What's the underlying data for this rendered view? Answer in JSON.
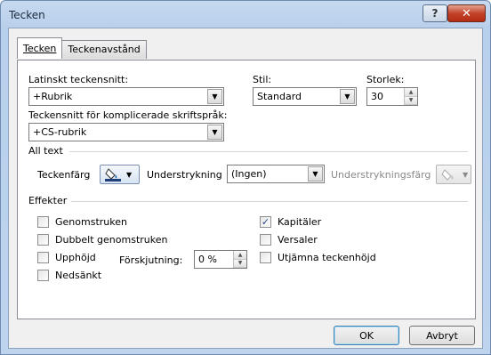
{
  "window": {
    "title": "Tecken",
    "help_glyph": "?",
    "close_glyph": "✕"
  },
  "tabs": [
    {
      "label": "Tecken"
    },
    {
      "label": "Teckenavstånd"
    }
  ],
  "font": {
    "latin_label": "Latinskt teckensnitt:",
    "latin_value": "+Rubrik",
    "style_label": "Stil:",
    "style_value": "Standard",
    "size_label": "Storlek:",
    "size_value": "30",
    "complex_label": "Teckensnitt för komplicerade skriftspråk:",
    "complex_value": "+CS-rubrik"
  },
  "all_text": {
    "group_label": "All text",
    "font_color_label": "Teckenfärg",
    "underline_label": "Understrykning",
    "underline_value": "(Ingen)",
    "underline_color_label": "Understrykningsfärg"
  },
  "effects": {
    "group_label": "Effekter",
    "strikethrough": "Genomstruken",
    "double_strikethrough": "Dubbelt genomstruken",
    "superscript": "Upphöjd",
    "offset_label": "Förskjutning:",
    "offset_value": "0 %",
    "subscript": "Nedsänkt",
    "small_caps": "Kapitäler",
    "all_caps": "Versaler",
    "equalize": "Utjämna teckenhöjd",
    "small_caps_checked": true
  },
  "buttons": {
    "ok": "OK",
    "cancel": "Avbryt"
  }
}
